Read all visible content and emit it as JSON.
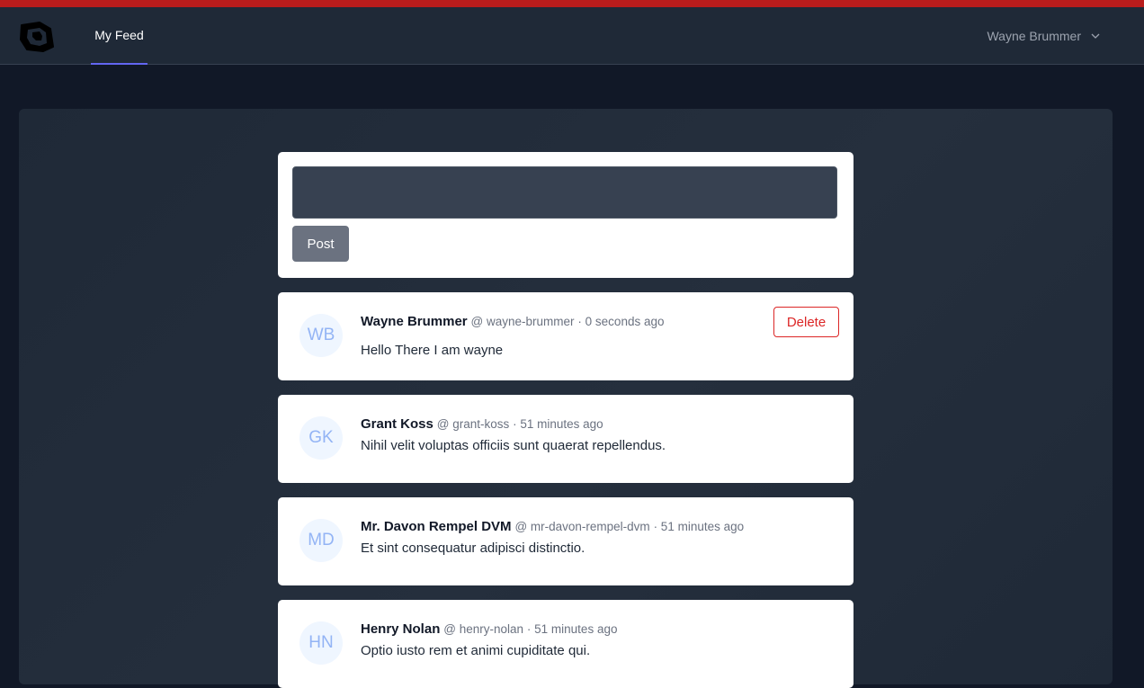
{
  "nav": {
    "logo": "app-logo",
    "tab_label": "My Feed",
    "user_name": "Wayne Brummer"
  },
  "composer": {
    "value": "",
    "post_label": "Post"
  },
  "posts": [
    {
      "initials": "WB",
      "author": "Wayne Brummer",
      "handle": "@ wayne-brummer",
      "time": "· 0 seconds ago",
      "body": "Hello There I am wayne",
      "delete_label": "Delete"
    },
    {
      "initials": "GK",
      "author": "Grant Koss",
      "handle": "@ grant-koss",
      "time": "· 51 minutes ago",
      "body": "Nihil velit voluptas officiis sunt quaerat repellendus."
    },
    {
      "initials": "MD",
      "author": "Mr. Davon Rempel DVM",
      "handle": "@ mr-davon-rempel-dvm",
      "time": "· 51 minutes ago",
      "body": "Et sint consequatur adipisci distinctio."
    },
    {
      "initials": "HN",
      "author": "Henry Nolan",
      "handle": "@ henry-nolan",
      "time": "· 51 minutes ago",
      "body": "Optio iusto rem et animi cupiditate qui."
    }
  ],
  "colors": {
    "accent": "#6366f1",
    "danger": "#dc2626",
    "top_strip": "#b91c1c"
  }
}
